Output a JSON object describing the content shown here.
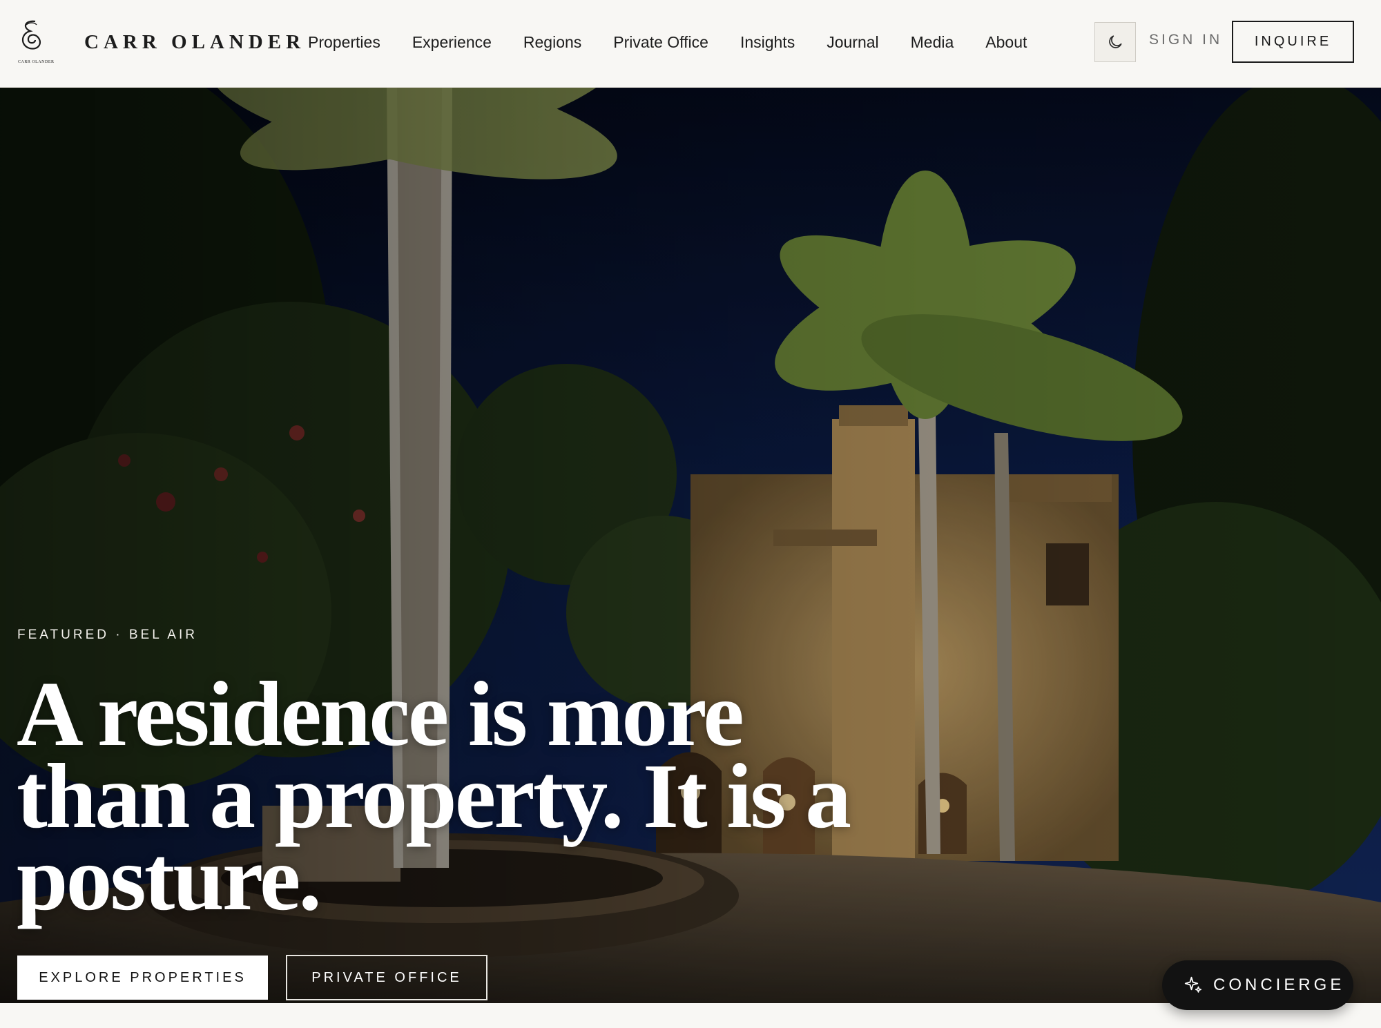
{
  "brand": {
    "name": "CARR OLANDER",
    "mark_caption": "CARR OLANDER"
  },
  "nav": {
    "items": [
      {
        "label": "Properties"
      },
      {
        "label": "Experience"
      },
      {
        "label": "Regions"
      },
      {
        "label": "Private Office"
      },
      {
        "label": "Insights"
      },
      {
        "label": "Journal"
      },
      {
        "label": "Media"
      },
      {
        "label": "About"
      }
    ],
    "theme_toggle_icon": "moon-icon",
    "sign_in_label": "SIGN IN",
    "inquire_label": "INQUIRE"
  },
  "hero": {
    "kicker": "FEATURED · BEL AIR",
    "headline": "A residence is more than a property. It is a posture.",
    "primary_cta": "EXPLORE PROPERTIES",
    "secondary_cta": "PRIVATE OFFICE"
  },
  "concierge": {
    "label": "CONCIERGE",
    "icon": "sparkle-icon"
  },
  "colors": {
    "header_bg": "#f8f7f4",
    "ink": "#1a1a1a",
    "night_sky": "#0c1a3e",
    "concierge_bg": "#121212"
  }
}
